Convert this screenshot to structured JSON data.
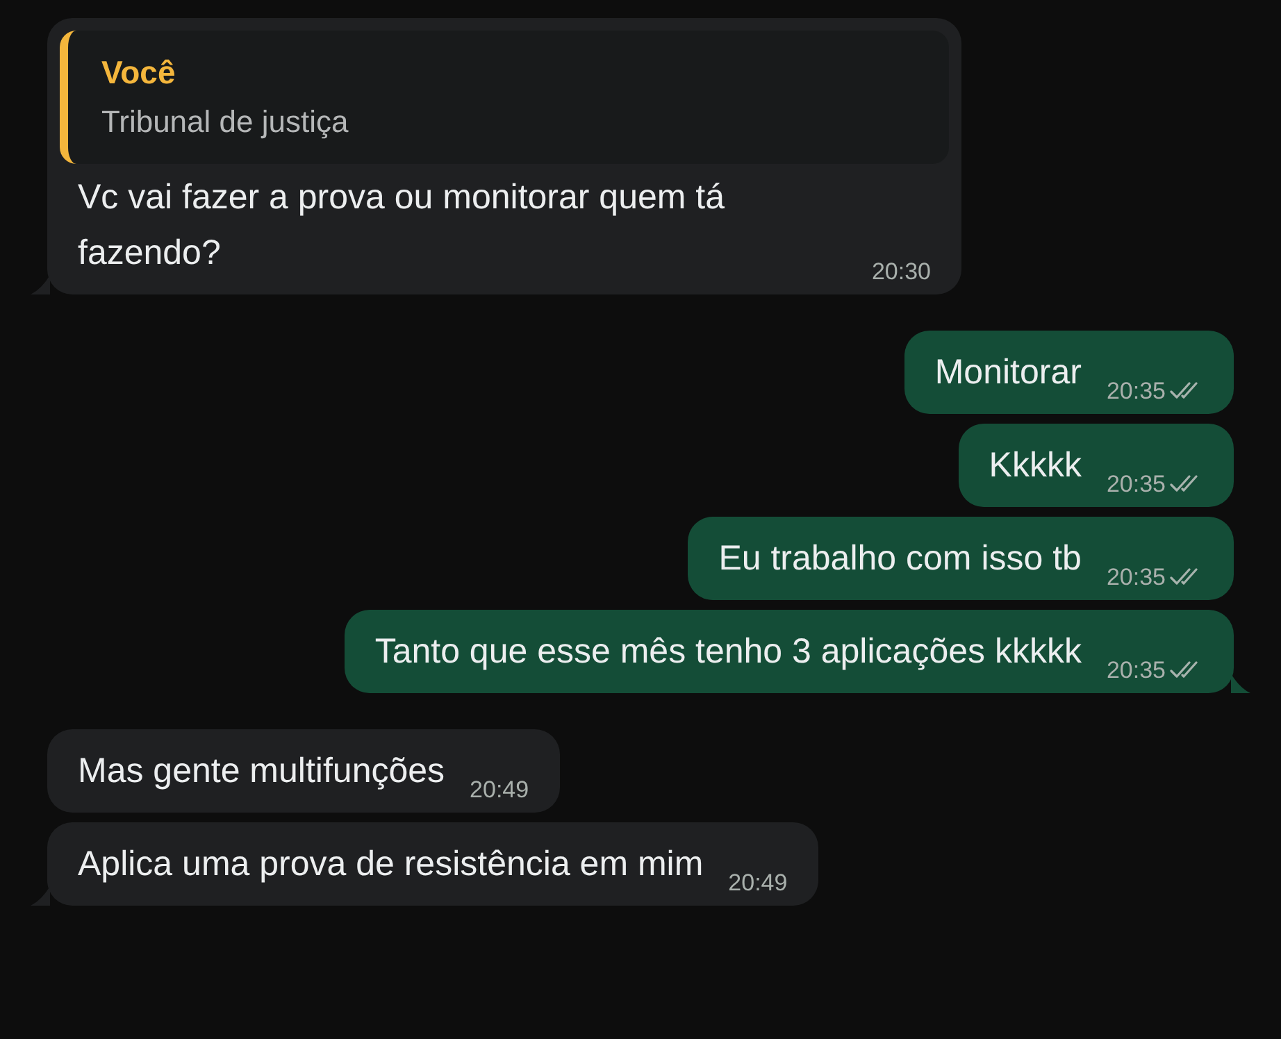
{
  "messages": [
    {
      "kind": "incoming",
      "quote": {
        "author": "Você",
        "text": "Tribunal de justiça"
      },
      "text": "Vc vai fazer a prova ou monitorar quem tá fazendo?",
      "time": "20:30"
    },
    {
      "kind": "outgoing",
      "text": "Monitorar",
      "time": "20:35"
    },
    {
      "kind": "outgoing",
      "text": "Kkkkk",
      "time": "20:35"
    },
    {
      "kind": "outgoing",
      "text": "Eu trabalho com isso tb",
      "time": "20:35"
    },
    {
      "kind": "outgoing",
      "text": "Tanto que esse mês tenho 3 aplicações kkkkk",
      "time": "20:35"
    },
    {
      "kind": "incoming",
      "text": "Mas gente multifunções",
      "time": "20:49"
    },
    {
      "kind": "incoming",
      "text": "Aplica uma prova de resistência em mim",
      "time": "20:49"
    }
  ]
}
